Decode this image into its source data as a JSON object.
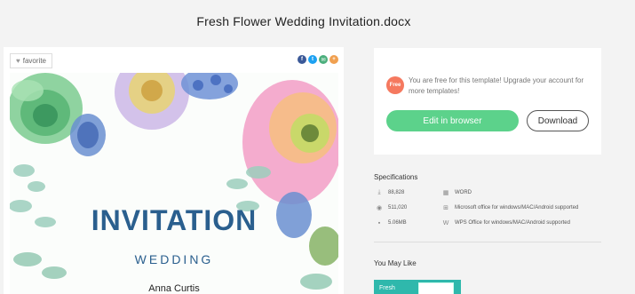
{
  "page": {
    "title": "Fresh Flower Wedding Invitation.docx"
  },
  "preview": {
    "favorite_label": "favorite",
    "share": [
      {
        "icon": "facebook-icon",
        "glyph": "f",
        "color": "#3b5998"
      },
      {
        "icon": "twitter-icon",
        "glyph": "t",
        "color": "#1da1f2"
      },
      {
        "icon": "email-icon",
        "glyph": "✉",
        "color": "#4caf7d"
      },
      {
        "icon": "share-icon",
        "glyph": "+",
        "color": "#f0a050"
      }
    ],
    "document": {
      "heading": "INVITATION",
      "subheading": "WEDDING",
      "name": "Anna Curtis"
    }
  },
  "action": {
    "badge": "Free",
    "message": "You are free for this template! Upgrade your account for more templates!",
    "edit_label": "Edit in browser",
    "download_label": "Download",
    "accent": "#5cd28b"
  },
  "specifications": {
    "title": "Specifications",
    "items": [
      {
        "icon": "download-count-icon",
        "text": "88,828"
      },
      {
        "icon": "word-icon",
        "text": "WORD"
      },
      {
        "icon": "view-count-icon",
        "text": "511,020"
      },
      {
        "icon": "windows-icon",
        "text": "Microsoft office for windows/MAC/Android supported"
      },
      {
        "icon": "file-size-icon",
        "text": "5.06MB"
      },
      {
        "icon": "wps-icon",
        "text": "WPS Office for windows/MAC/Android supported"
      }
    ]
  },
  "you_may_like": {
    "title": "You May Like",
    "items": [
      {
        "label": "Fresh"
      }
    ]
  }
}
